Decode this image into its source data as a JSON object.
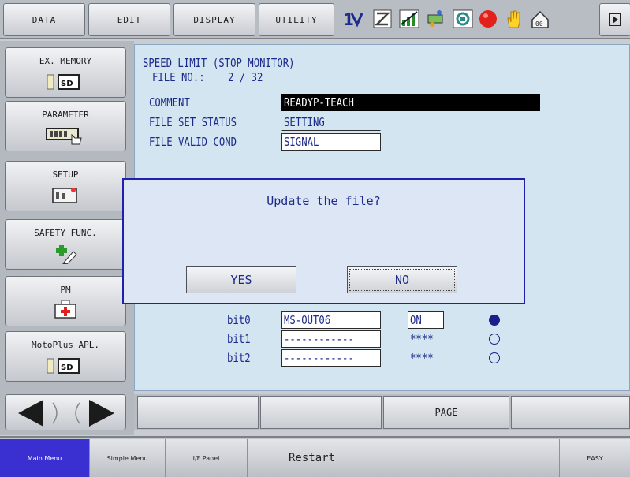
{
  "top_menu": {
    "items": [
      "DATA",
      "EDIT",
      "DISPLAY",
      "UTILITY"
    ]
  },
  "status_icons": [
    "job-cycle-icon",
    "step-icon",
    "speed-icon",
    "tool-icon",
    "mode-icon",
    "servo-stop-icon",
    "hand-icon",
    "security-icon"
  ],
  "sidebar": {
    "items": [
      {
        "label": "EX. MEMORY",
        "icon": "sd-card-icon",
        "sub": "SD"
      },
      {
        "label": "PARAMETER",
        "icon": "parameter-icon"
      },
      {
        "label": "SETUP",
        "icon": "setup-icon"
      },
      {
        "label": "SAFETY FUNC.",
        "icon": "safety-icon"
      },
      {
        "label": "PM",
        "icon": "pm-icon"
      },
      {
        "label": "MotoPlus APL.",
        "icon": "sd-card-icon",
        "sub": "SD"
      }
    ]
  },
  "main": {
    "title": "SPEED LIMIT (STOP MONITOR)",
    "file_no_label": "FILE NO.:",
    "file_no_value": "2 / 32",
    "comment_label": "COMMENT",
    "comment_value": "READYP-TEACH",
    "file_set_label": "FILE SET STATUS",
    "file_set_value": "SETTING",
    "file_valid_label": "FILE VALID COND",
    "file_valid_value": "SIGNAL",
    "bits": [
      {
        "label": "bit0",
        "signal": "MS-OUT06",
        "state": "ON",
        "indicator": "filled"
      },
      {
        "label": "bit1",
        "signal": "------------",
        "state": "****",
        "indicator": "empty"
      },
      {
        "label": "bit2",
        "signal": "------------",
        "state": "****",
        "indicator": "empty"
      }
    ]
  },
  "dialog": {
    "message": "Update the file?",
    "yes_label": "YES",
    "no_label": "NO"
  },
  "function_bar": {
    "items": [
      "",
      "",
      "PAGE",
      ""
    ]
  },
  "bottom_nav": {
    "main_menu": "Main Menu",
    "simple_menu": "Simple Menu",
    "if_panel": "I/F Panel",
    "restart": "Restart",
    "easy": "EASY"
  },
  "colors": {
    "main_bg": "#d2e5f0",
    "text": "#1b2a8a",
    "dialog_border": "#1f1fb0",
    "main_menu_tab": "#3a2fd0"
  }
}
